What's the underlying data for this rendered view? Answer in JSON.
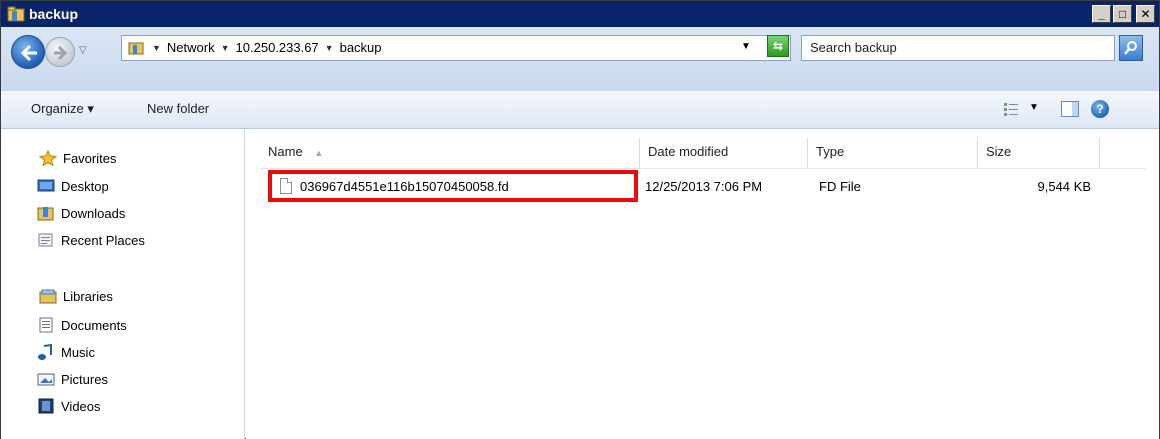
{
  "window": {
    "title": "backup",
    "controls": {
      "minimize": "_",
      "maximize": "□",
      "close": "✕"
    }
  },
  "address": {
    "crumbs": [
      "Network",
      "10.250.233.67",
      "backup"
    ],
    "search_placeholder": "Search backup"
  },
  "toolbar": {
    "organize_label": "Organize ▾",
    "new_folder_label": "New folder",
    "help_label": "?"
  },
  "nav": {
    "favorites": {
      "label": "Favorites",
      "items": [
        "Desktop",
        "Downloads",
        "Recent Places"
      ]
    },
    "libraries": {
      "label": "Libraries",
      "items": [
        "Documents",
        "Music",
        "Pictures",
        "Videos"
      ]
    }
  },
  "columns": {
    "name": "Name",
    "date": "Date modified",
    "type": "Type",
    "size": "Size"
  },
  "files": [
    {
      "name": "036967d4551e116b15070450058.fd",
      "date": "12/25/2013 7:06 PM",
      "type": "FD File",
      "size": "9,544 KB"
    }
  ],
  "colors": {
    "titlebar": "#0a246a",
    "highlight": "#ee0a0a"
  }
}
